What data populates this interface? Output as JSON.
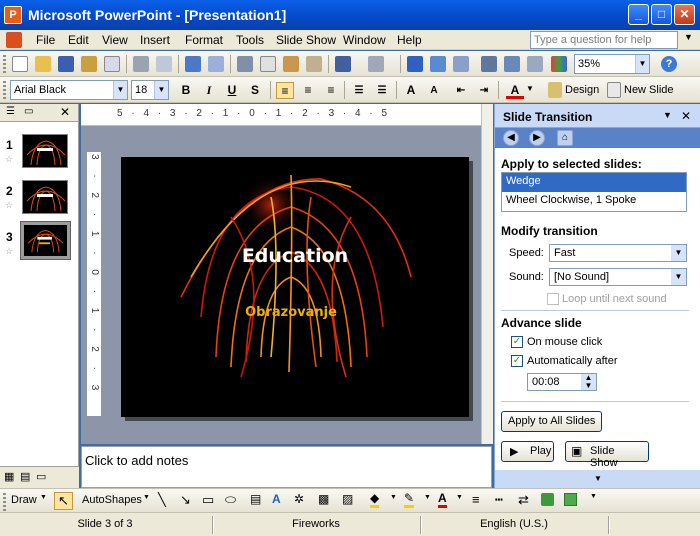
{
  "window": {
    "title": "Microsoft PowerPoint - [Presentation1]"
  },
  "menu": {
    "items": [
      "File",
      "Edit",
      "View",
      "Insert",
      "Format",
      "Tools",
      "Slide Show",
      "Window",
      "Help"
    ]
  },
  "help": {
    "placeholder": "Type a question for help"
  },
  "standard_toolbar": {
    "zoom": "35%"
  },
  "formatting_toolbar": {
    "font": "Arial Black",
    "size": "18",
    "bold": "B",
    "italic": "I",
    "underline": "U",
    "shadow": "S",
    "font_color": "A",
    "design_label": "Design",
    "new_slide_label": "New Slide"
  },
  "slides_pane": {
    "thumbnails": [
      {
        "number": "1"
      },
      {
        "number": "2"
      },
      {
        "number": "3",
        "selected": true
      }
    ]
  },
  "slide": {
    "title": "Education",
    "subtitle": "Obrazovanje",
    "ruler_h": "5 · 4 · 3 · 2 · 1 · 0 · 1 · 2 · 3 · 4 · 5",
    "ruler_v": "3 · 2 · 1 · 0 · 1 · 2 · 3"
  },
  "notes": {
    "placeholder": "Click to add notes"
  },
  "task_pane": {
    "title": "Slide Transition",
    "apply_header": "Apply to selected slides:",
    "transitions": [
      "Wedge",
      "Wheel Clockwise, 1 Spoke"
    ],
    "selected_transition": "Wedge",
    "modify_header": "Modify transition",
    "speed_label": "Speed:",
    "speed_value": "Fast",
    "sound_label": "Sound:",
    "sound_value": "[No Sound]",
    "loop_label": "Loop until next sound",
    "advance_header": "Advance slide",
    "on_click_label": "On mouse click",
    "auto_label": "Automatically after",
    "auto_time": "00:08",
    "apply_all_label": "Apply to All Slides",
    "play_label": "Play",
    "slideshow_label": "Slide Show"
  },
  "drawing_toolbar": {
    "draw_label": "Draw",
    "autoshapes_label": "AutoShapes"
  },
  "status": {
    "slide": "Slide 3 of 3",
    "design": "Fireworks",
    "language": "English (U.S.)"
  },
  "colors": {
    "title_bar": "#0a5fe8",
    "selection": "#316ac5",
    "task_pane_header": "#c8daf6",
    "slide_bg": "#000000",
    "subtitle": "#f0b000"
  }
}
